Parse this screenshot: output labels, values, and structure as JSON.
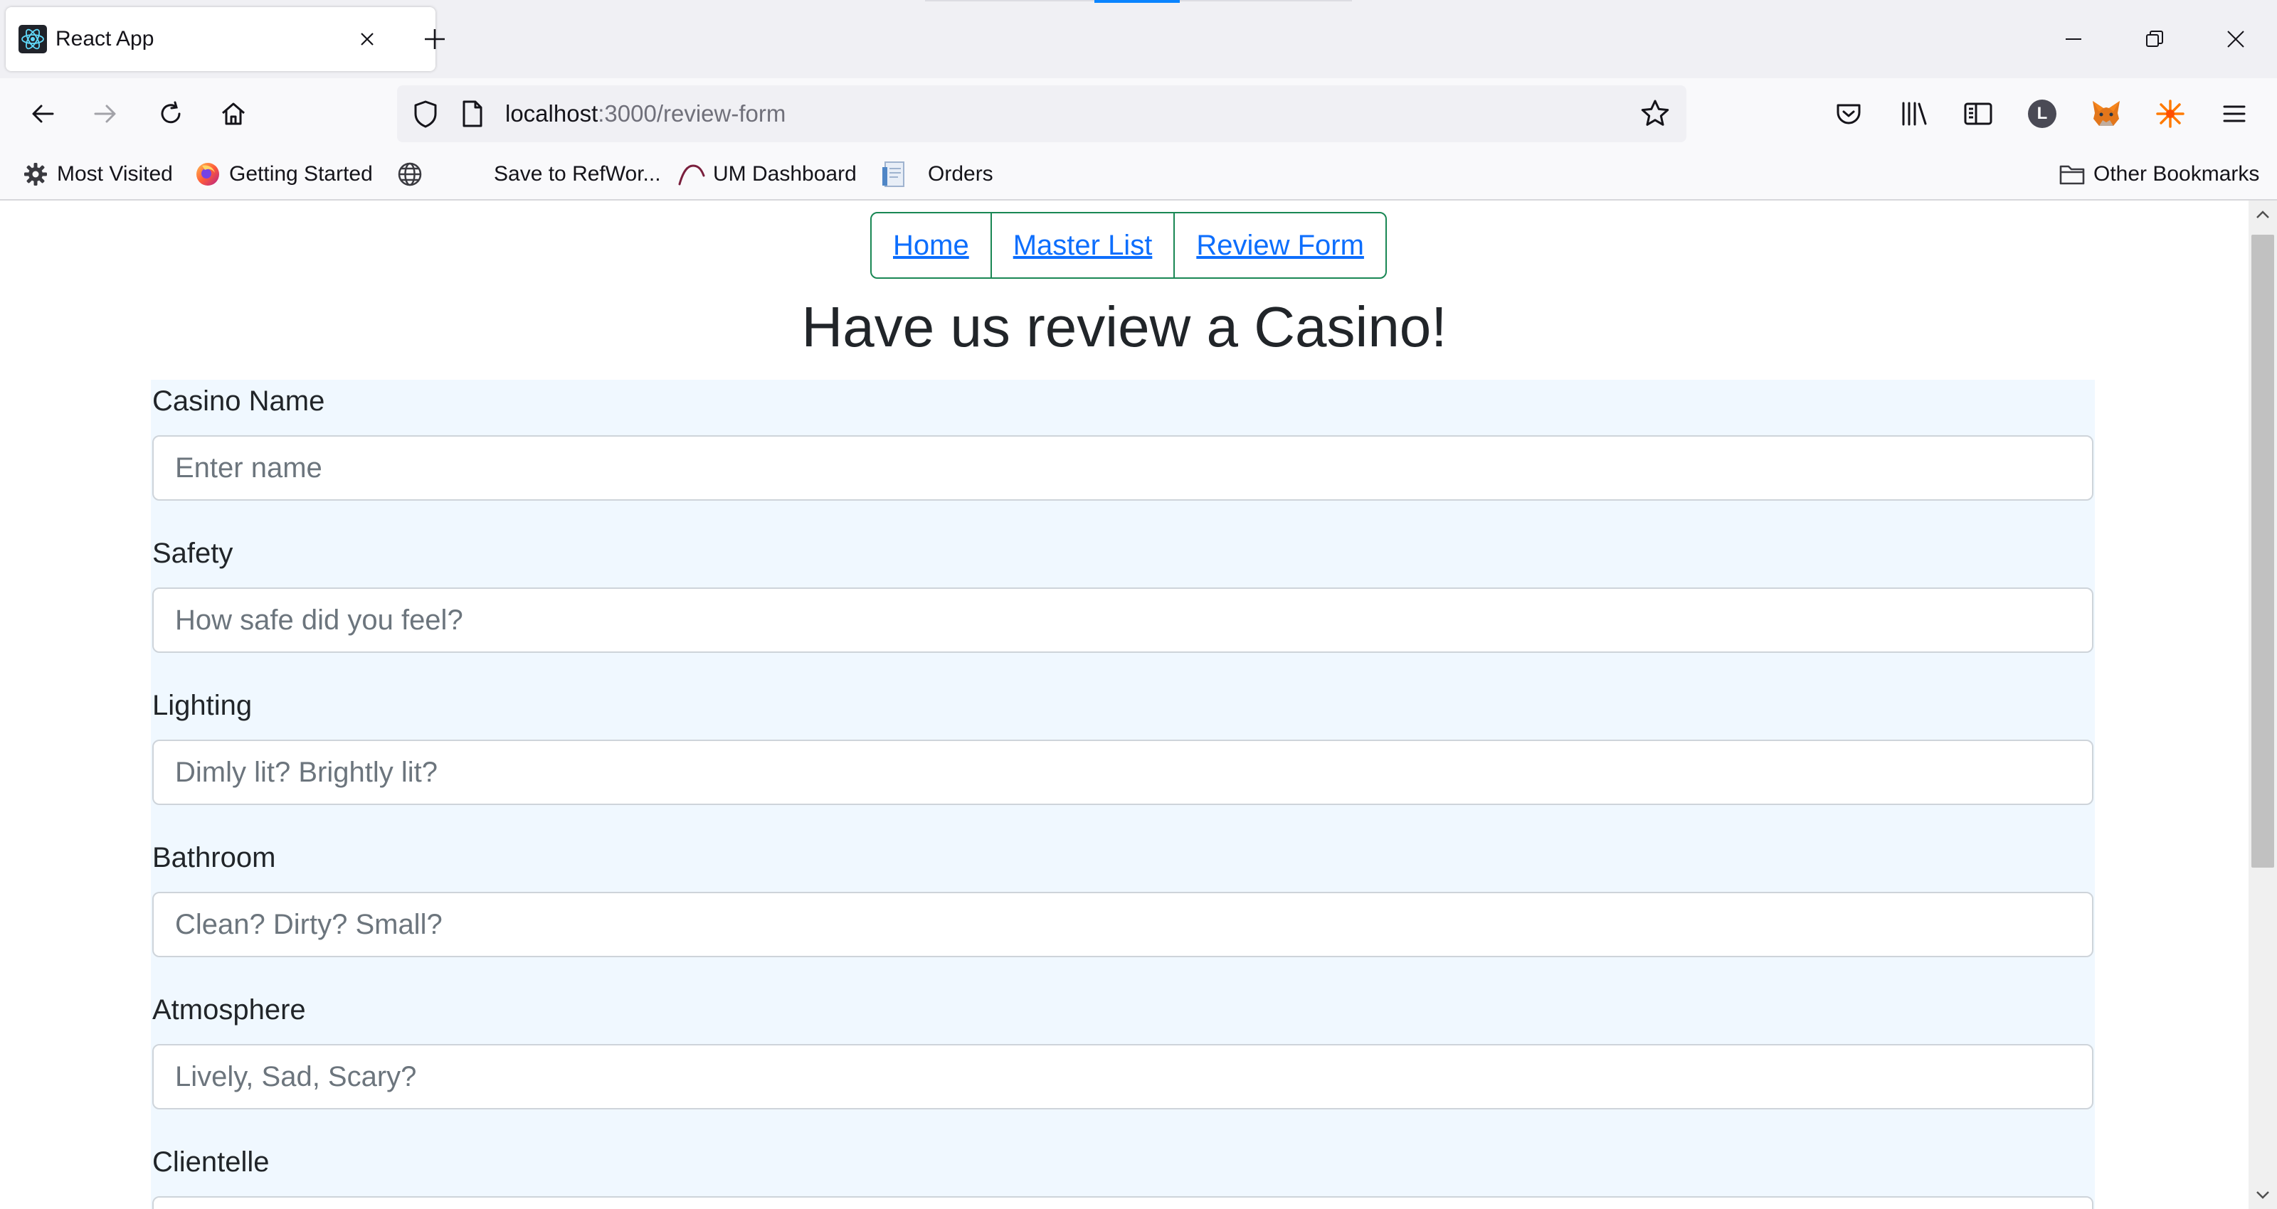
{
  "browser": {
    "tab": {
      "title": "React App"
    },
    "url": {
      "host": "localhost",
      "path": ":3000/review-form"
    },
    "profile_initial": "L",
    "accent_color": "#0a84ff",
    "bookmarks": [
      {
        "label": "Most Visited",
        "icon": "gear-icon"
      },
      {
        "label": "Getting Started",
        "icon": "firefox-icon"
      },
      {
        "label": "",
        "icon": "globe-icon"
      },
      {
        "label": "Save to RefWor...",
        "icon": ""
      },
      {
        "label": "UM Dashboard",
        "icon": "um-icon"
      },
      {
        "label": "Orders",
        "icon": "document-icon"
      }
    ],
    "other_bookmarks": "Other Bookmarks"
  },
  "site": {
    "nav": [
      {
        "label": "Home"
      },
      {
        "label": "Master List"
      },
      {
        "label": "Review Form"
      }
    ],
    "nav_border_color": "#198754",
    "link_color": "#0d6efd",
    "heading": "Have us review a Casino!",
    "form_background": "#f0f8ff",
    "form": {
      "fields": [
        {
          "label": "Casino Name",
          "placeholder": "Enter name",
          "value": ""
        },
        {
          "label": "Safety",
          "placeholder": "How safe did you feel?",
          "value": ""
        },
        {
          "label": "Lighting",
          "placeholder": "Dimly lit? Brightly lit?",
          "value": ""
        },
        {
          "label": "Bathroom",
          "placeholder": "Clean? Dirty? Small?",
          "value": ""
        },
        {
          "label": "Atmosphere",
          "placeholder": "Lively, Sad, Scary?",
          "value": ""
        },
        {
          "label": "Clientelle",
          "placeholder": "",
          "value": ""
        }
      ]
    }
  }
}
